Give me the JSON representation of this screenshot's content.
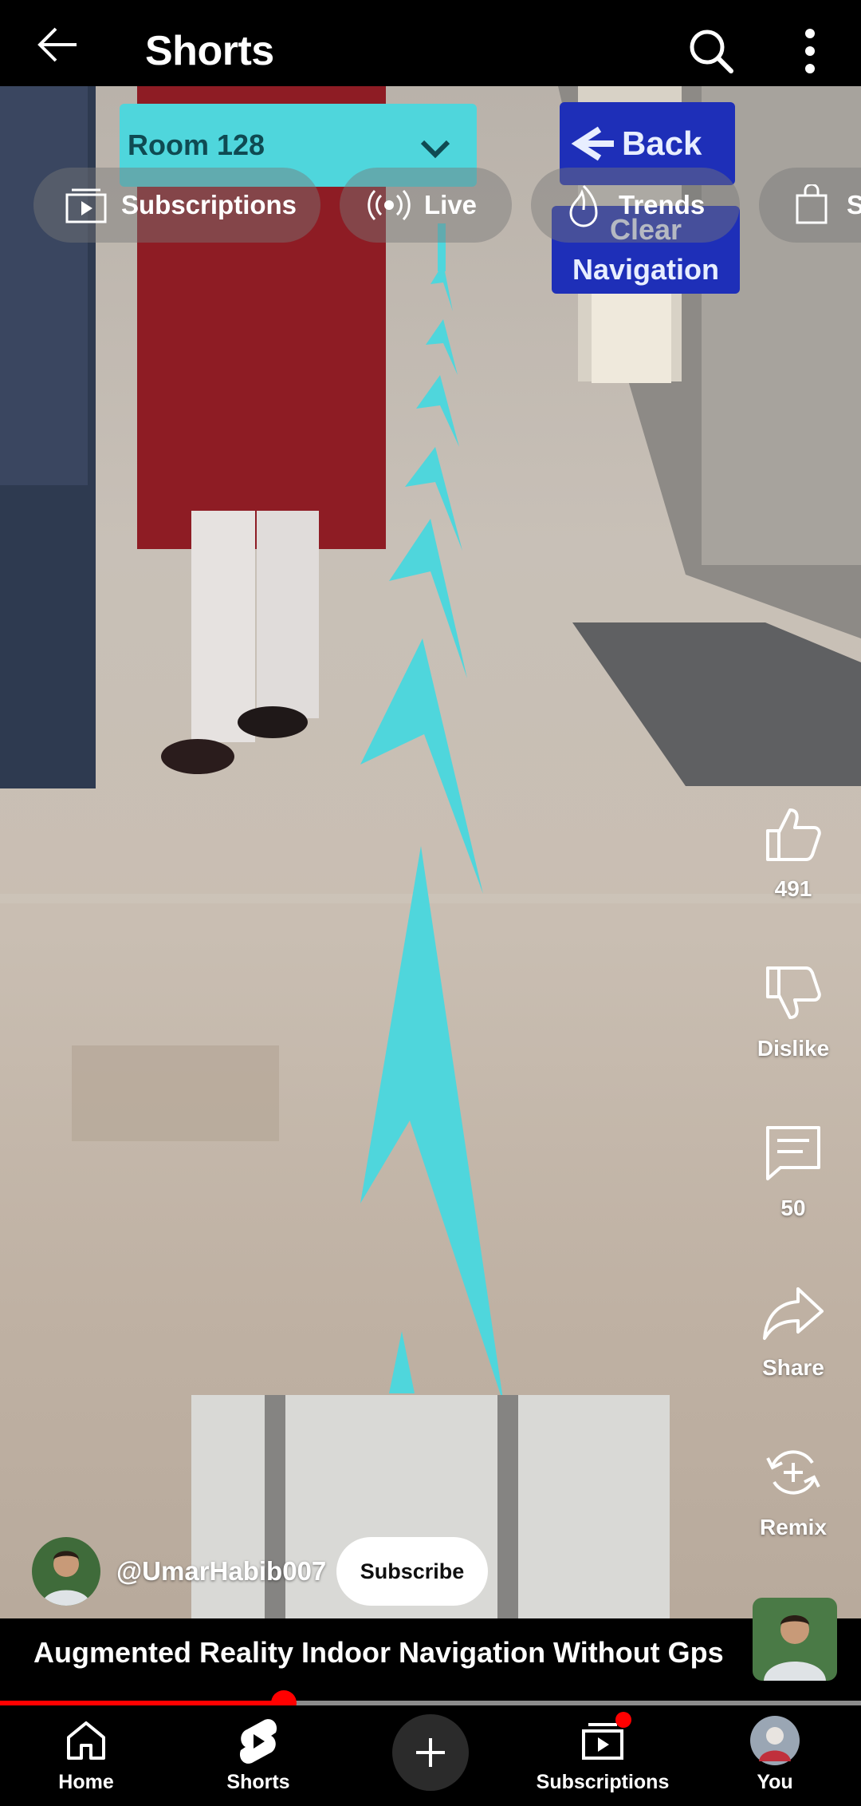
{
  "header": {
    "title": "Shorts"
  },
  "chips": [
    {
      "label": "Subscriptions",
      "icon": "subscriptions-icon"
    },
    {
      "label": "Live",
      "icon": "live-icon"
    },
    {
      "label": "Trends",
      "icon": "trends-icon"
    },
    {
      "label": "S",
      "icon": "shopping-bag-icon"
    }
  ],
  "video_overlay": {
    "room_selector": "Room 128",
    "back_button": "Back",
    "clear_line1": "Clear",
    "clear_line2": "Navigation"
  },
  "actions": {
    "like_count": "491",
    "dislike_label": "Dislike",
    "comment_count": "50",
    "share_label": "Share",
    "remix_label": "Remix"
  },
  "channel": {
    "handle": "@UmarHabib007",
    "subscribe_label": "Subscribe"
  },
  "video": {
    "title": "Augmented Reality Indoor Navigation Without Gps",
    "progress": 0.33
  },
  "nav": {
    "home": "Home",
    "shorts": "Shorts",
    "subscriptions": "Subscriptions",
    "you": "You"
  },
  "colors": {
    "accent": "#ff0000",
    "ar_cyan": "#4fd6dc",
    "ar_blue": "#1e2fb8"
  }
}
